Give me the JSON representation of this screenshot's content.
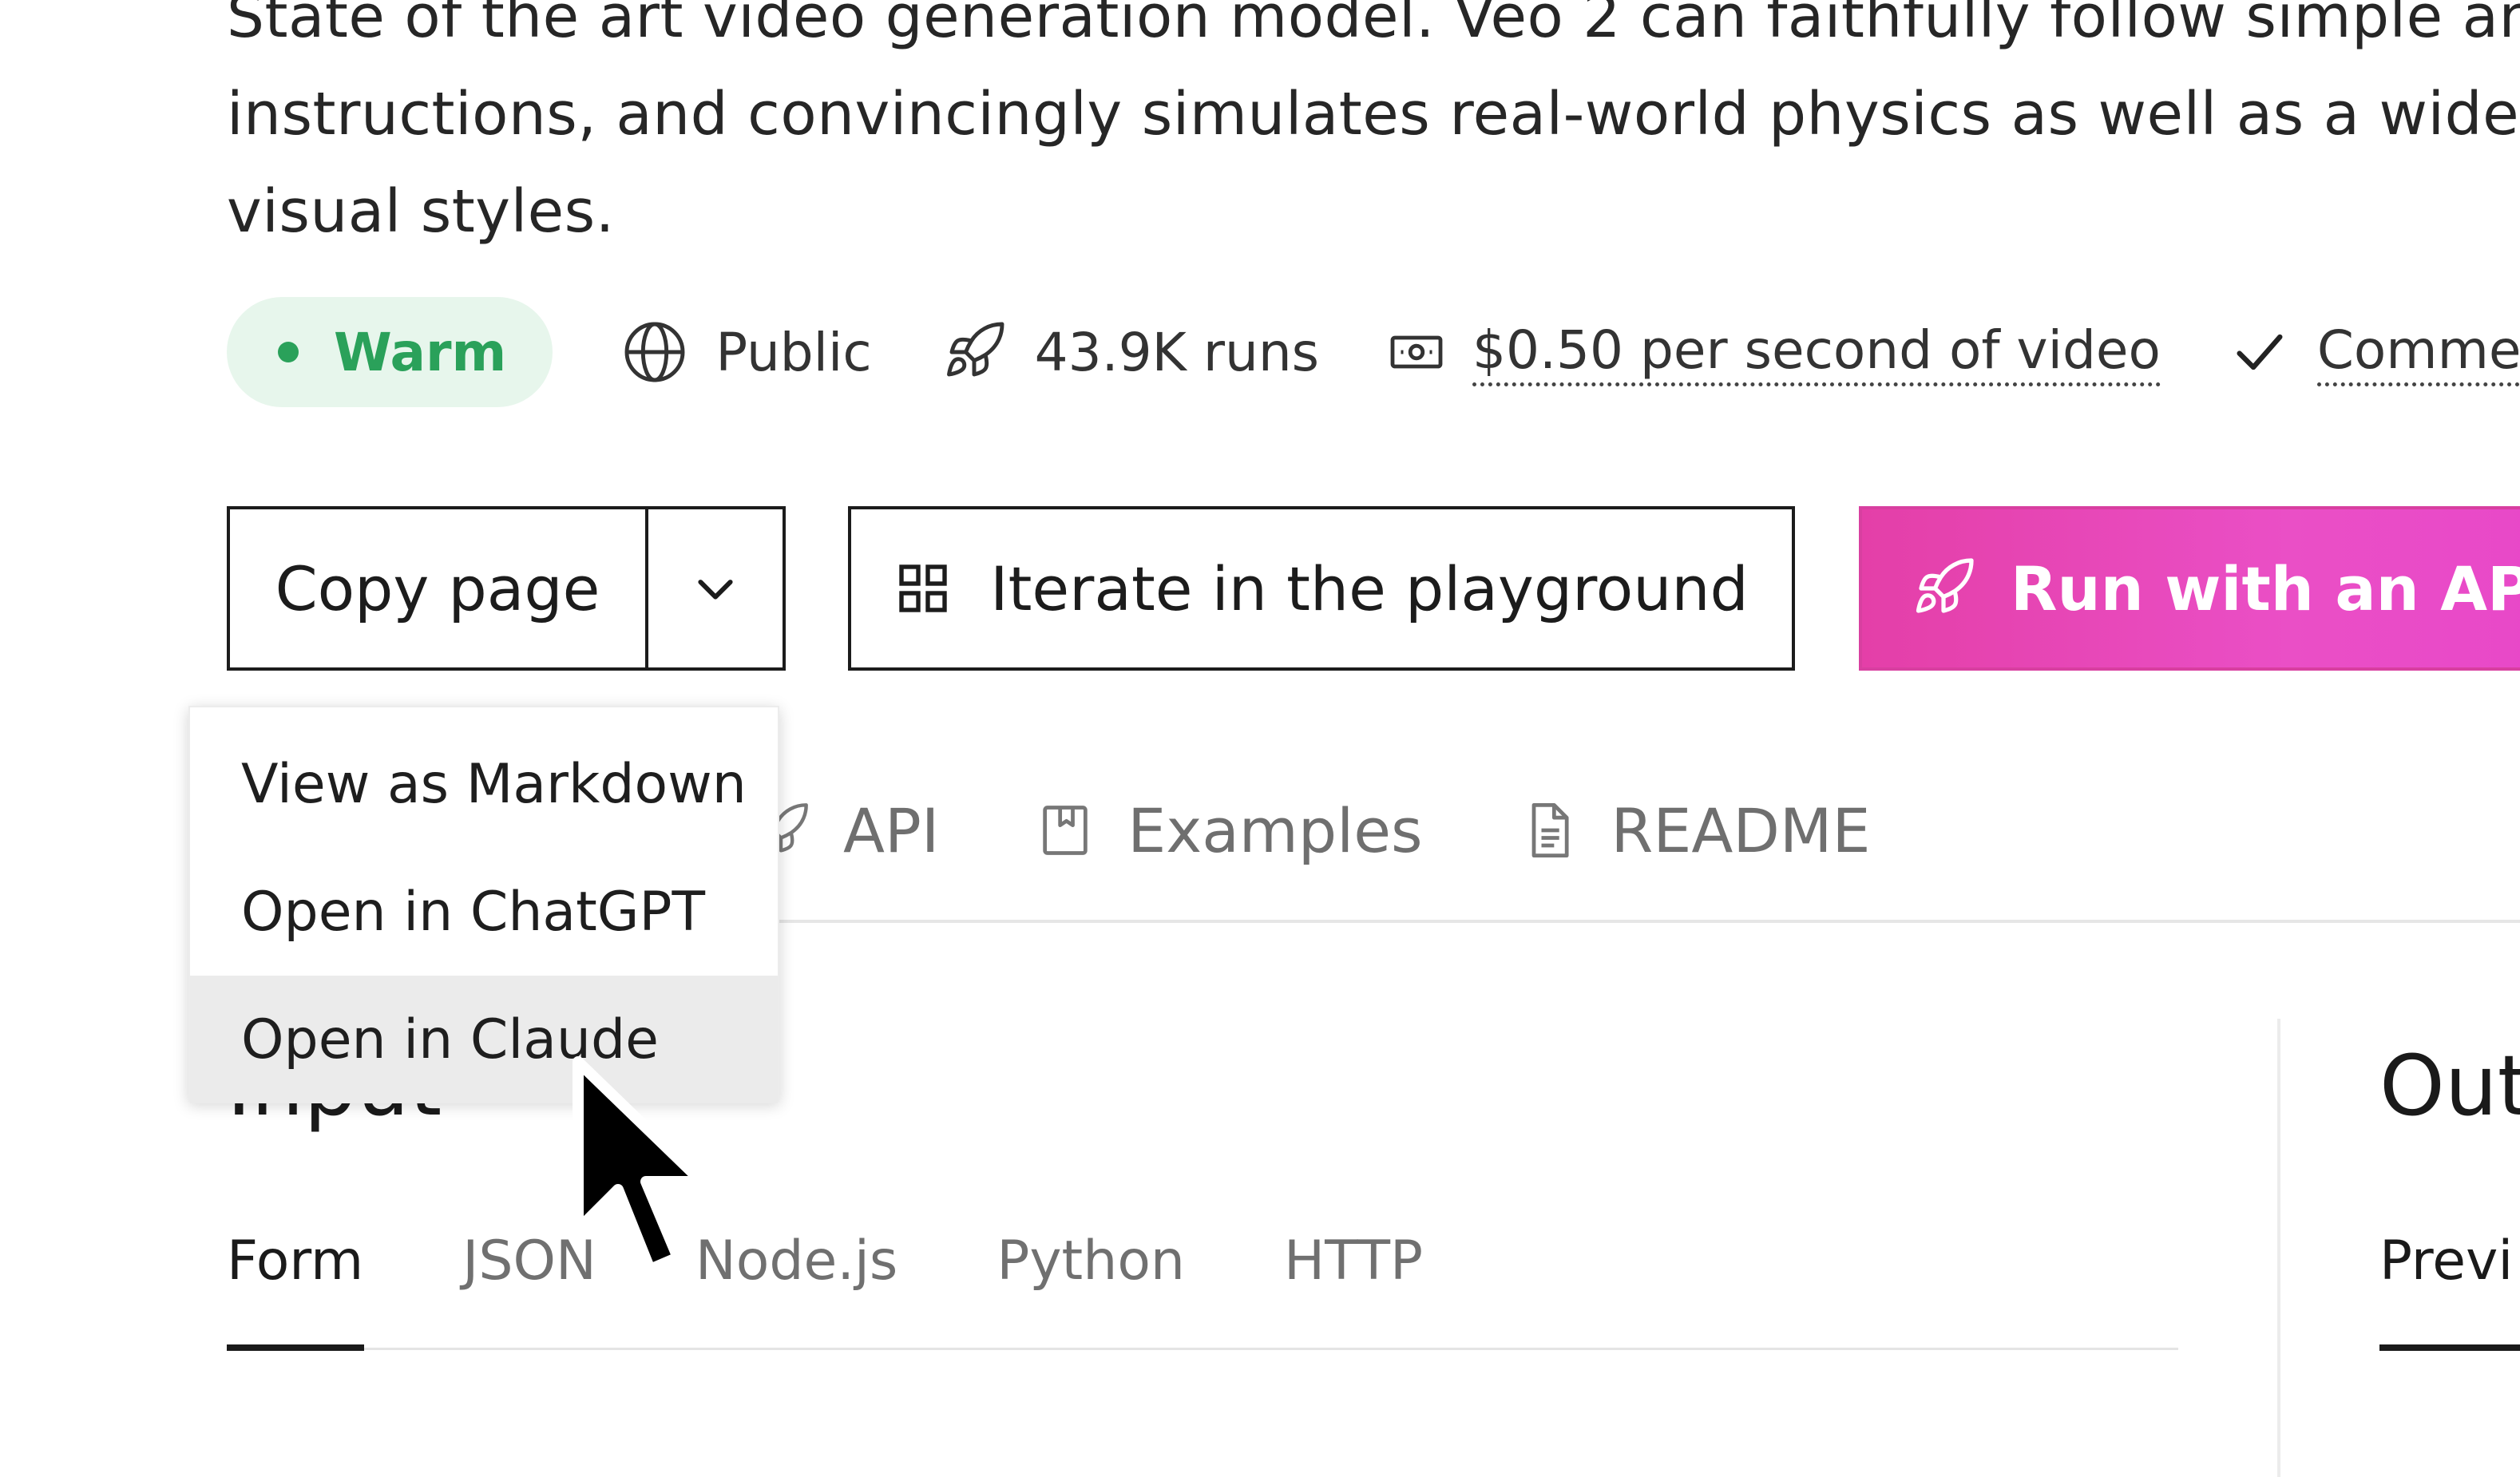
{
  "description": {
    "lines": [
      "State of the art video generation model. Veo 2 can faithfully follow simple and",
      "instructions, and convincingly simulates real-world physics as well as a wide",
      "visual styles."
    ]
  },
  "meta": {
    "status_label": "Warm",
    "status_color": "#2aa15a",
    "visibility": "Public",
    "runs": "43.9K runs",
    "price": "$0.50 per second of video",
    "commercial": "Commer"
  },
  "buttons": {
    "copy_page": "Copy page",
    "iterate": "Iterate in the playground",
    "run_api": "Run with an API"
  },
  "accent_colors": {
    "run_api_gradient_start": "#e43fa8",
    "run_api_gradient_end": "#e847c9"
  },
  "tabs": {
    "api": "API",
    "examples": "Examples",
    "readme": "README"
  },
  "dropdown": {
    "items": [
      "View as Markdown",
      "Open in ChatGPT",
      "Open in Claude"
    ]
  },
  "input": {
    "title": "Input",
    "subtabs": [
      "Form",
      "JSON",
      "Node.js",
      "Python",
      "HTTP"
    ]
  },
  "output": {
    "title": "Out",
    "subtab": "Previ"
  }
}
